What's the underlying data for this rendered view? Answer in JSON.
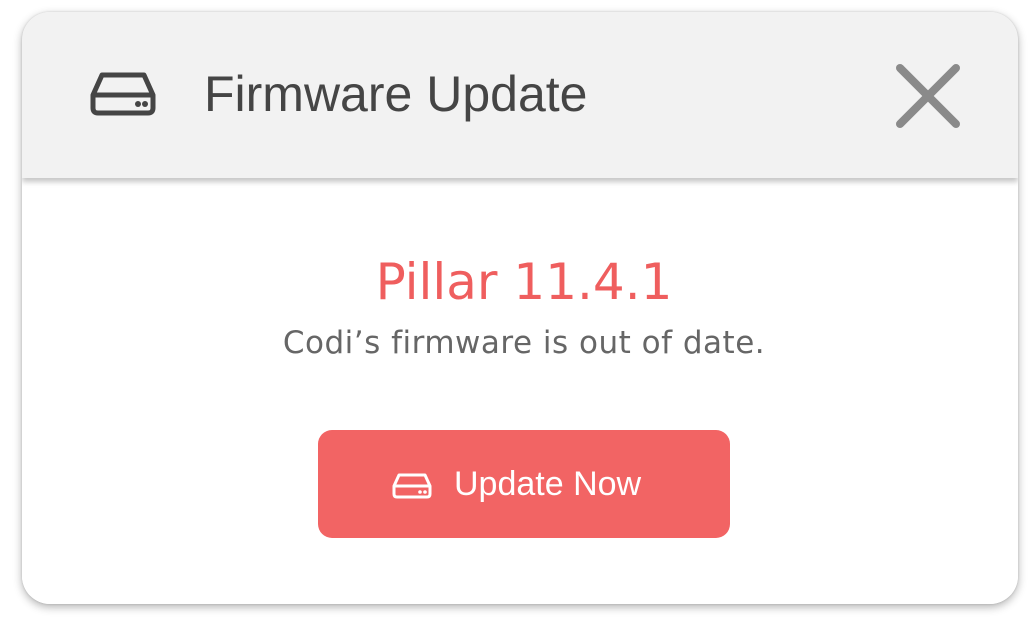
{
  "dialog": {
    "title": "Firmware Update",
    "title_icon": "hard-drive-icon",
    "close_icon": "close-icon"
  },
  "content": {
    "version_label": "Pillar 11.4.1",
    "message": "Codi’s firmware is out of date."
  },
  "action": {
    "button_label": "Update Now",
    "button_icon": "hard-drive-icon"
  },
  "colors": {
    "accent": "#f26464",
    "version_text": "#ef5e5e",
    "header_bg": "#f2f2f2",
    "title_text": "#454545",
    "body_text": "#666666",
    "close_icon": "#8a8a8a"
  }
}
